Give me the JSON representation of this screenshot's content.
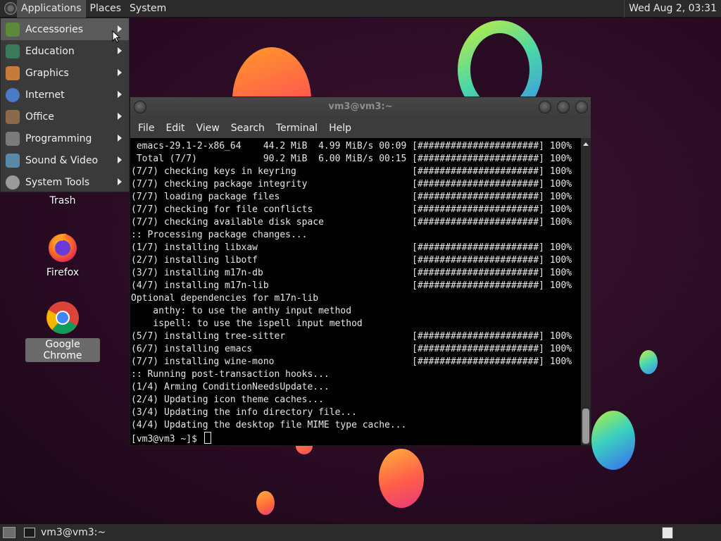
{
  "top_panel": {
    "menus": [
      "Applications",
      "Places",
      "System"
    ],
    "clock": "Wed Aug  2, 03:31"
  },
  "apps_menu": {
    "items": [
      {
        "label": "Accessories",
        "icon": "accessories-icon",
        "color": "#5a8a3a"
      },
      {
        "label": "Education",
        "icon": "education-icon",
        "color": "#3a7a5a"
      },
      {
        "label": "Graphics",
        "icon": "graphics-icon",
        "color": "#c87a3a"
      },
      {
        "label": "Internet",
        "icon": "internet-icon",
        "color": "#4a7ac8"
      },
      {
        "label": "Office",
        "icon": "office-icon",
        "color": "#8a6a4a"
      },
      {
        "label": "Programming",
        "icon": "programming-icon",
        "color": "#7a7a7a"
      },
      {
        "label": "Sound & Video",
        "icon": "sound-video-icon",
        "color": "#5a8aa8"
      },
      {
        "label": "System Tools",
        "icon": "system-tools-icon",
        "color": "#9a9a9a"
      }
    ]
  },
  "desktop_icons": [
    {
      "label": "Trash",
      "icon": "trash-icon"
    },
    {
      "label": "Firefox",
      "icon": "firefox-icon"
    },
    {
      "label": "Google Chrome",
      "icon": "chrome-icon"
    }
  ],
  "terminal": {
    "title": "vm3@vm3:~",
    "menus": [
      "File",
      "Edit",
      "View",
      "Search",
      "Terminal",
      "Help"
    ],
    "lines": [
      " emacs-29.1-2-x86_64    44.2 MiB  4.99 MiB/s 00:09 [######################] 100%",
      " Total (7/7)            90.2 MiB  6.00 MiB/s 00:15 [######################] 100%",
      "(7/7) checking keys in keyring                     [######################] 100%",
      "(7/7) checking package integrity                   [######################] 100%",
      "(7/7) loading package files                        [######################] 100%",
      "(7/7) checking for file conflicts                  [######################] 100%",
      "(7/7) checking available disk space                [######################] 100%",
      ":: Processing package changes...",
      "(1/7) installing libxaw                            [######################] 100%",
      "(2/7) installing libotf                            [######################] 100%",
      "(3/7) installing m17n-db                           [######################] 100%",
      "(4/7) installing m17n-lib                          [######################] 100%",
      "Optional dependencies for m17n-lib",
      "    anthy: to use the anthy input method",
      "    ispell: to use the ispell input method",
      "(5/7) installing tree-sitter                       [######################] 100%",
      "(6/7) installing emacs                             [######################] 100%",
      "(7/7) installing wine-mono                         [######################] 100%",
      ":: Running post-transaction hooks...",
      "(1/4) Arming ConditionNeedsUpdate...",
      "(2/4) Updating icon theme caches...",
      "(3/4) Updating the info directory file...",
      "(4/4) Updating the desktop file MIME type cache..."
    ],
    "prompt": "[vm3@vm3 ~]$ "
  },
  "bottom_panel": {
    "task_label": "vm3@vm3:~"
  }
}
